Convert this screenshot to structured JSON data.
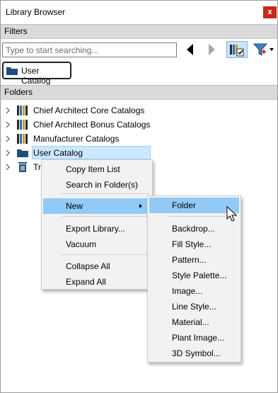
{
  "window": {
    "title": "Library Browser",
    "close_label": "x"
  },
  "filters": {
    "header": "Filters",
    "search_placeholder": "Type to start searching...",
    "catalog_chip": "User Catalog"
  },
  "folders": {
    "header": "Folders",
    "items": [
      {
        "label": "Chief Architect Core Catalogs",
        "icon": "books-icon"
      },
      {
        "label": "Chief Architect Bonus Catalogs",
        "icon": "books-icon"
      },
      {
        "label": "Manufacturer Catalogs",
        "icon": "books-icon"
      },
      {
        "label": "User Catalog",
        "icon": "folder-icon",
        "selected": true
      },
      {
        "label": "Tra",
        "icon": "trash-icon"
      }
    ]
  },
  "context_menu": {
    "items": [
      "Copy Item List",
      "Search in Folder(s)",
      "New",
      "Export Library...",
      "Vacuum",
      "Collapse All",
      "Expand All"
    ]
  },
  "submenu": {
    "items": [
      "Folder",
      "Backdrop...",
      "Fill Style...",
      "Pattern...",
      "Style Palette...",
      "Image...",
      "Line Style...",
      "Material...",
      "Plant Image...",
      "3D Symbol..."
    ]
  },
  "colors": {
    "highlight": "#91c9f7",
    "selection": "#cce8ff",
    "close": "#c42b1c",
    "folder": "#1f4e79"
  }
}
